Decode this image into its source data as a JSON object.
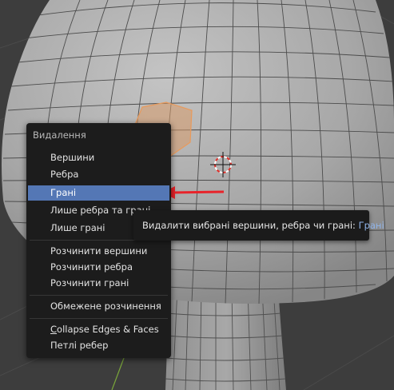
{
  "menu": {
    "title": "Видалення",
    "items": [
      {
        "label": "Вершини"
      },
      {
        "label": "Ребра"
      },
      {
        "label": "Грані",
        "active": true
      },
      {
        "label": "Лише ребра та грані"
      },
      {
        "label": "Лише грані"
      },
      {
        "label": "Розчинити вершини"
      },
      {
        "label": "Розчинити ребра"
      },
      {
        "label": "Розчинити грані"
      },
      {
        "label": "Обмежене розчинення"
      },
      {
        "label_first": "C",
        "label_rest": "ollapse Edges & Faces"
      },
      {
        "label": "Петлі ребер"
      }
    ]
  },
  "tooltip": {
    "text": "Видалити вибрані вершини, ребра чи грані:",
    "value": "Грані"
  },
  "colors": {
    "menu_bg": "#1c1c1c",
    "highlight": "#5477b5",
    "arrow": "#e8232a",
    "mesh_face": "#a9a9a9",
    "selected_face": "#d79a6a"
  }
}
